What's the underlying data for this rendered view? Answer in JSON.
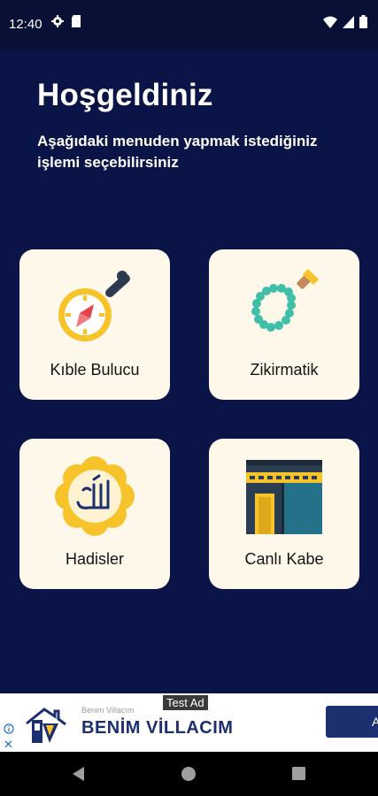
{
  "status": {
    "time": "12:40"
  },
  "header": {
    "title": "Hoşgeldiniz",
    "subtitle": "Aşağıdaki menuden yapmak istediğiniz işlemi seçebilirsiniz"
  },
  "menu": [
    {
      "label": "Kıble Bulucu",
      "icon": "compass-icon"
    },
    {
      "label": "Zikirmatik",
      "icon": "prayer-beads-icon"
    },
    {
      "label": "Hadisler",
      "icon": "allah-calligraphy-icon"
    },
    {
      "label": "Canlı Kabe",
      "icon": "kaaba-icon"
    }
  ],
  "ad": {
    "tag": "Test Ad",
    "brand_small": "Benim Villacım",
    "brand_large": "BENİM VİLLACIM",
    "button_label": "A",
    "close": "✕"
  },
  "colors": {
    "background": "#0b1446",
    "tile": "#fdf8ea",
    "accent_yellow": "#f7c32a",
    "ad_blue": "#1c2f6e"
  }
}
